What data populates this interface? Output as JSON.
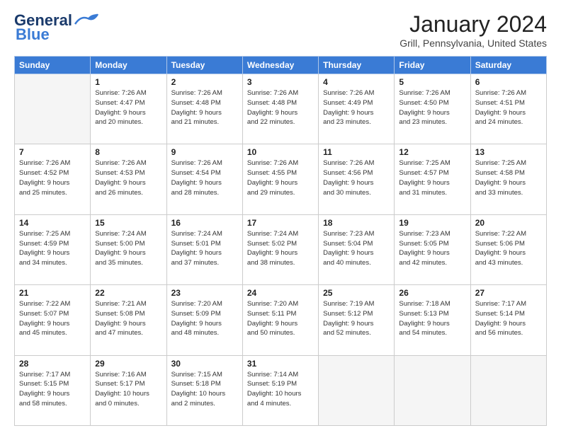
{
  "header": {
    "logo_line1": "General",
    "logo_line2": "Blue",
    "title": "January 2024",
    "subtitle": "Grill, Pennsylvania, United States"
  },
  "days_of_week": [
    "Sunday",
    "Monday",
    "Tuesday",
    "Wednesday",
    "Thursday",
    "Friday",
    "Saturday"
  ],
  "weeks": [
    [
      {
        "day": "",
        "detail": ""
      },
      {
        "day": "1",
        "detail": "Sunrise: 7:26 AM\nSunset: 4:47 PM\nDaylight: 9 hours\nand 20 minutes."
      },
      {
        "day": "2",
        "detail": "Sunrise: 7:26 AM\nSunset: 4:48 PM\nDaylight: 9 hours\nand 21 minutes."
      },
      {
        "day": "3",
        "detail": "Sunrise: 7:26 AM\nSunset: 4:48 PM\nDaylight: 9 hours\nand 22 minutes."
      },
      {
        "day": "4",
        "detail": "Sunrise: 7:26 AM\nSunset: 4:49 PM\nDaylight: 9 hours\nand 23 minutes."
      },
      {
        "day": "5",
        "detail": "Sunrise: 7:26 AM\nSunset: 4:50 PM\nDaylight: 9 hours\nand 23 minutes."
      },
      {
        "day": "6",
        "detail": "Sunrise: 7:26 AM\nSunset: 4:51 PM\nDaylight: 9 hours\nand 24 minutes."
      }
    ],
    [
      {
        "day": "7",
        "detail": "Sunrise: 7:26 AM\nSunset: 4:52 PM\nDaylight: 9 hours\nand 25 minutes."
      },
      {
        "day": "8",
        "detail": "Sunrise: 7:26 AM\nSunset: 4:53 PM\nDaylight: 9 hours\nand 26 minutes."
      },
      {
        "day": "9",
        "detail": "Sunrise: 7:26 AM\nSunset: 4:54 PM\nDaylight: 9 hours\nand 28 minutes."
      },
      {
        "day": "10",
        "detail": "Sunrise: 7:26 AM\nSunset: 4:55 PM\nDaylight: 9 hours\nand 29 minutes."
      },
      {
        "day": "11",
        "detail": "Sunrise: 7:26 AM\nSunset: 4:56 PM\nDaylight: 9 hours\nand 30 minutes."
      },
      {
        "day": "12",
        "detail": "Sunrise: 7:25 AM\nSunset: 4:57 PM\nDaylight: 9 hours\nand 31 minutes."
      },
      {
        "day": "13",
        "detail": "Sunrise: 7:25 AM\nSunset: 4:58 PM\nDaylight: 9 hours\nand 33 minutes."
      }
    ],
    [
      {
        "day": "14",
        "detail": "Sunrise: 7:25 AM\nSunset: 4:59 PM\nDaylight: 9 hours\nand 34 minutes."
      },
      {
        "day": "15",
        "detail": "Sunrise: 7:24 AM\nSunset: 5:00 PM\nDaylight: 9 hours\nand 35 minutes."
      },
      {
        "day": "16",
        "detail": "Sunrise: 7:24 AM\nSunset: 5:01 PM\nDaylight: 9 hours\nand 37 minutes."
      },
      {
        "day": "17",
        "detail": "Sunrise: 7:24 AM\nSunset: 5:02 PM\nDaylight: 9 hours\nand 38 minutes."
      },
      {
        "day": "18",
        "detail": "Sunrise: 7:23 AM\nSunset: 5:04 PM\nDaylight: 9 hours\nand 40 minutes."
      },
      {
        "day": "19",
        "detail": "Sunrise: 7:23 AM\nSunset: 5:05 PM\nDaylight: 9 hours\nand 42 minutes."
      },
      {
        "day": "20",
        "detail": "Sunrise: 7:22 AM\nSunset: 5:06 PM\nDaylight: 9 hours\nand 43 minutes."
      }
    ],
    [
      {
        "day": "21",
        "detail": "Sunrise: 7:22 AM\nSunset: 5:07 PM\nDaylight: 9 hours\nand 45 minutes."
      },
      {
        "day": "22",
        "detail": "Sunrise: 7:21 AM\nSunset: 5:08 PM\nDaylight: 9 hours\nand 47 minutes."
      },
      {
        "day": "23",
        "detail": "Sunrise: 7:20 AM\nSunset: 5:09 PM\nDaylight: 9 hours\nand 48 minutes."
      },
      {
        "day": "24",
        "detail": "Sunrise: 7:20 AM\nSunset: 5:11 PM\nDaylight: 9 hours\nand 50 minutes."
      },
      {
        "day": "25",
        "detail": "Sunrise: 7:19 AM\nSunset: 5:12 PM\nDaylight: 9 hours\nand 52 minutes."
      },
      {
        "day": "26",
        "detail": "Sunrise: 7:18 AM\nSunset: 5:13 PM\nDaylight: 9 hours\nand 54 minutes."
      },
      {
        "day": "27",
        "detail": "Sunrise: 7:17 AM\nSunset: 5:14 PM\nDaylight: 9 hours\nand 56 minutes."
      }
    ],
    [
      {
        "day": "28",
        "detail": "Sunrise: 7:17 AM\nSunset: 5:15 PM\nDaylight: 9 hours\nand 58 minutes."
      },
      {
        "day": "29",
        "detail": "Sunrise: 7:16 AM\nSunset: 5:17 PM\nDaylight: 10 hours\nand 0 minutes."
      },
      {
        "day": "30",
        "detail": "Sunrise: 7:15 AM\nSunset: 5:18 PM\nDaylight: 10 hours\nand 2 minutes."
      },
      {
        "day": "31",
        "detail": "Sunrise: 7:14 AM\nSunset: 5:19 PM\nDaylight: 10 hours\nand 4 minutes."
      },
      {
        "day": "",
        "detail": ""
      },
      {
        "day": "",
        "detail": ""
      },
      {
        "day": "",
        "detail": ""
      }
    ]
  ]
}
